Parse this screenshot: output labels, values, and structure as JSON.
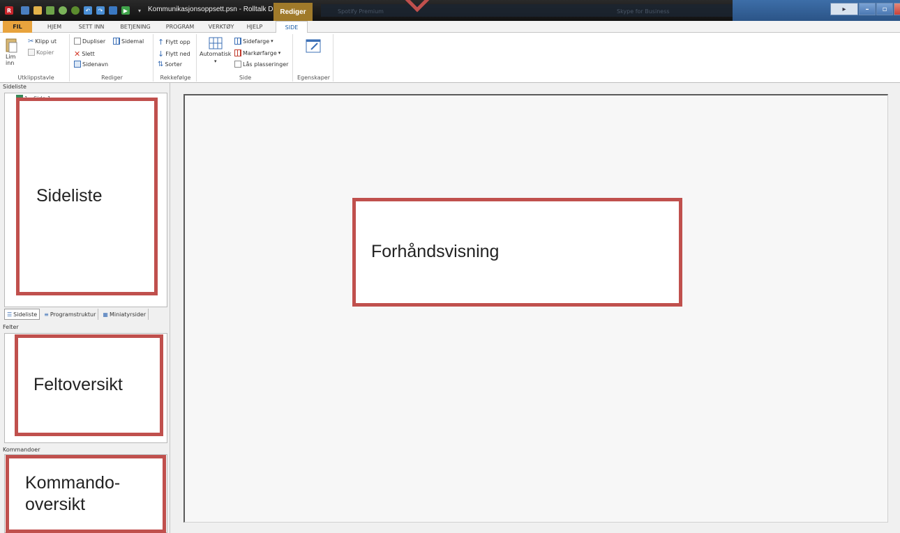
{
  "titlebar": {
    "document_title": "Kommunikasjonsoppsett.psn - Rolltalk Desig...",
    "context_tab": "Rediger",
    "ghost_left": "Spotify Premium",
    "ghost_right": "Skype for Business"
  },
  "ribbon_tabs": [
    "FIL",
    "HJEM",
    "SETT INN",
    "BETJENING",
    "PROGRAM",
    "VERKTØY",
    "HJELP",
    "SIDE"
  ],
  "ribbon": {
    "clipboard": {
      "paste": "Lim inn",
      "cut": "Klipp ut",
      "copy": "Kopier",
      "label": "Utklippstavle"
    },
    "edit": {
      "duplicate": "Dupliser",
      "template": "Sidemal",
      "delete": "Slett",
      "pagename": "Sidenavn",
      "label": "Rediger"
    },
    "order": {
      "move_up": "Flytt opp",
      "move_down": "Flytt ned",
      "sort": "Sorter",
      "label": "Rekkefølge"
    },
    "page": {
      "auto": "Automatisk",
      "page_color": "Sidefarge",
      "marker_color": "Markørfarge",
      "lock": "Lås plasseringer",
      "label": "Side"
    },
    "properties": {
      "label": "Egenskaper"
    }
  },
  "panels": {
    "pagelist_header": "Sideliste",
    "page_item": "1 - Side 1",
    "tabs": [
      "Sideliste",
      "Programstruktur",
      "Miniatyrsider"
    ],
    "fields_header": "Felter",
    "commands_header": "Kommandoer"
  },
  "annotations": {
    "pagelist": "Sideliste",
    "preview": "Forhåndsvisning",
    "fields": "Feltoversikt",
    "commands_line1": "Kommando-",
    "commands_line2": "oversikt"
  },
  "colors": {
    "annotation_border": "#c0504d",
    "file_tab": "#e8a33d",
    "context_tab": "#a07a2a"
  }
}
